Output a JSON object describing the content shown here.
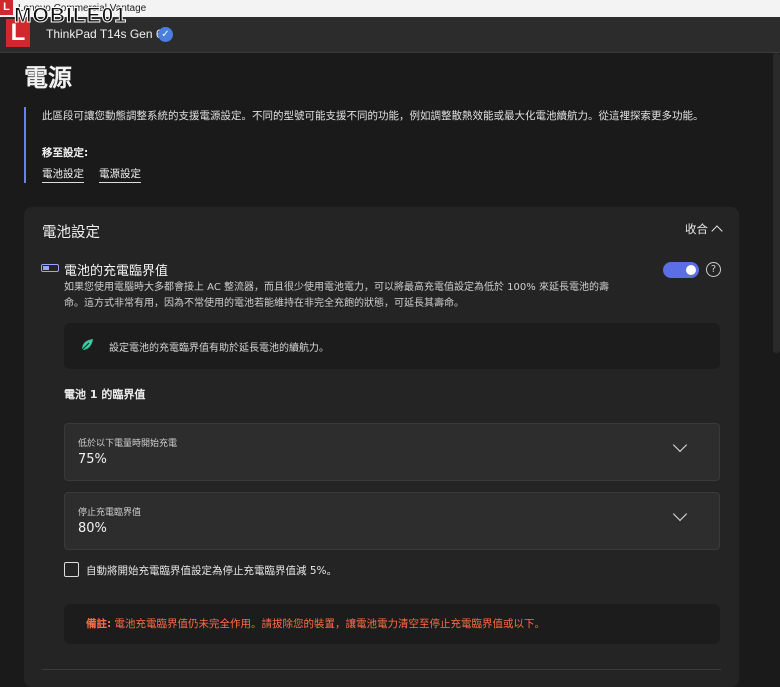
{
  "window": {
    "title": "Lenovo Commercial Vantage"
  },
  "watermark": {
    "text": "MOBILE01",
    "logo_letter": "L"
  },
  "header": {
    "device_name": "ThinkPad T14s Gen 6",
    "verified_glyph": "✓"
  },
  "page": {
    "title": "電源",
    "intro": "此區段可讓您動態調整系統的支援電源設定。不同的型號可能支援不同的功能，例如調整散熱效能或最大化電池續航力。從這裡探索更多功能。",
    "goto_label": "移至設定:",
    "goto_links": [
      "電池設定",
      "電源設定"
    ]
  },
  "battery_card": {
    "title": "電池設定",
    "collapse_label": "收合",
    "section_title": "電池的充電臨界值",
    "section_desc": "如果您使用電腦時大多都會接上 AC 整流器，而且很少使用電池電力，可以將最高充電值設定為低於 100% 來延長電池的壽命。這方式非常有用，因為不常使用的電池若能維持在非完全充飽的狀態，可延長其壽命。",
    "toggle_on": true,
    "help_glyph": "?",
    "tip": "設定電池的充電臨界值有助於延長電池的續航力。",
    "threshold_title": "電池 1 的臨界值",
    "start_dropdown": {
      "label": "低於以下電量時開始充電",
      "value": "75%"
    },
    "stop_dropdown": {
      "label": "停止充電臨界值",
      "value": "80%"
    },
    "auto_checkbox_label": "自動將開始充電臨界值設定為停止充電臨界值減 5%。",
    "note_prefix": "備註:",
    "note_text": " 電池充電臨界值仍未完全作用。請拔除您的裝置，讓電池電力清空至停止充電臨界值或以下。"
  },
  "colors": {
    "accent": "#5b6ee6",
    "warning": "#ff6b4a",
    "brand_red": "#d0282e"
  }
}
